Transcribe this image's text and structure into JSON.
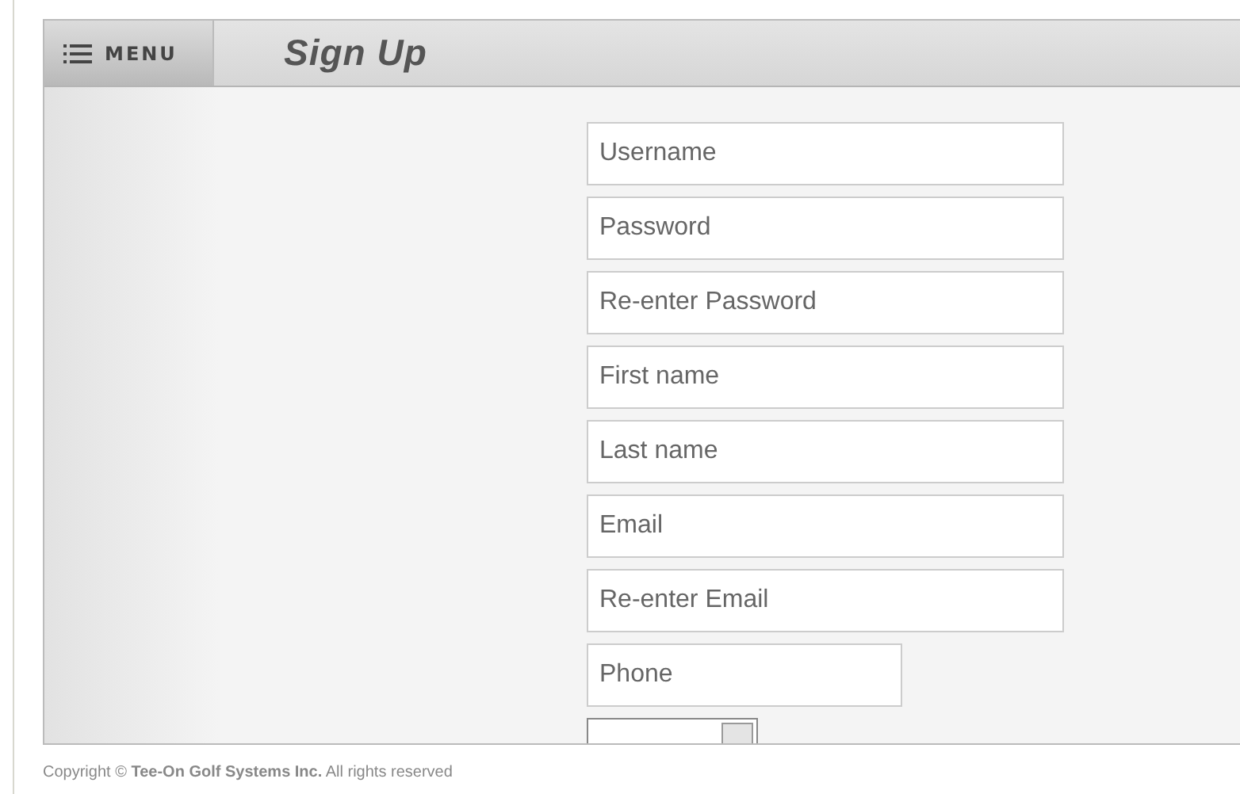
{
  "header": {
    "menu_label": "MENU",
    "title": "Sign Up"
  },
  "fields": [
    {
      "placeholder": "Username",
      "kind": "wide"
    },
    {
      "placeholder": "Password",
      "kind": "wide"
    },
    {
      "placeholder": "Re-enter Password",
      "kind": "wide"
    },
    {
      "placeholder": "First name",
      "kind": "wide"
    },
    {
      "placeholder": "Last name",
      "kind": "wide"
    },
    {
      "placeholder": "Email",
      "kind": "wide"
    },
    {
      "placeholder": "Re-enter Email",
      "kind": "wide"
    },
    {
      "placeholder": "Phone",
      "kind": "narrow"
    }
  ],
  "footer": {
    "copyright": "Copyright © **Tee-On Golf Systems Inc.** All rights reserved"
  }
}
